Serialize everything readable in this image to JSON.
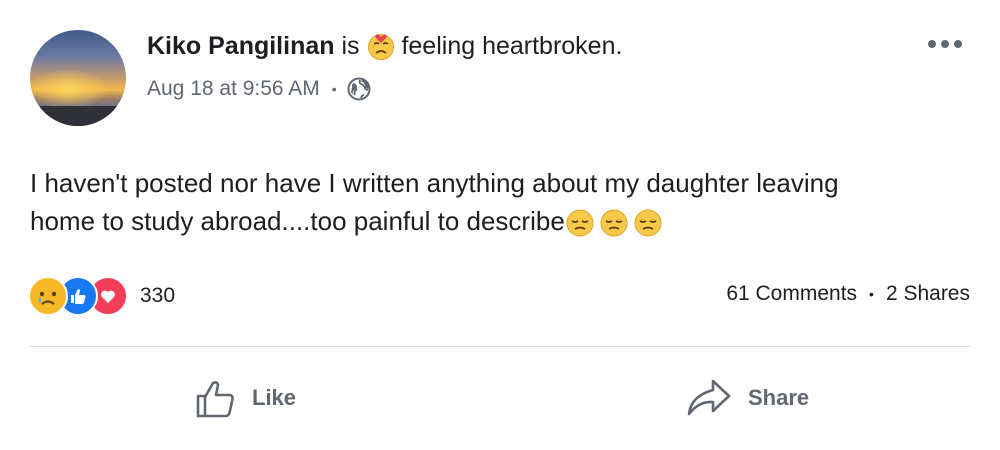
{
  "post": {
    "author": "Kiko Pangilinan",
    "is_text": "is",
    "feeling_text": "feeling heartbroken.",
    "feeling_icon": "heartbroken-emoji",
    "date": "Aug 18 at 9:56 AM",
    "privacy_icon": "globe-icon",
    "text_line1": "I haven't posted nor have I written anything about my daughter leaving",
    "text_line2": "home to study abroad....too painful to describe",
    "trailing_emoji": [
      "pensive-emoji",
      "pensive-emoji",
      "pensive-emoji"
    ]
  },
  "reactions": {
    "icons": [
      "sad-reaction-icon",
      "like-reaction-icon",
      "love-reaction-icon"
    ],
    "count": "330",
    "colors": {
      "like": "#1877f2",
      "love": "#f33e58",
      "sad": "#f7b928"
    }
  },
  "engagement": {
    "comments": "61 Comments",
    "separator": "•",
    "shares": "2 Shares"
  },
  "actions": {
    "like_label": "Like",
    "share_label": "Share"
  }
}
